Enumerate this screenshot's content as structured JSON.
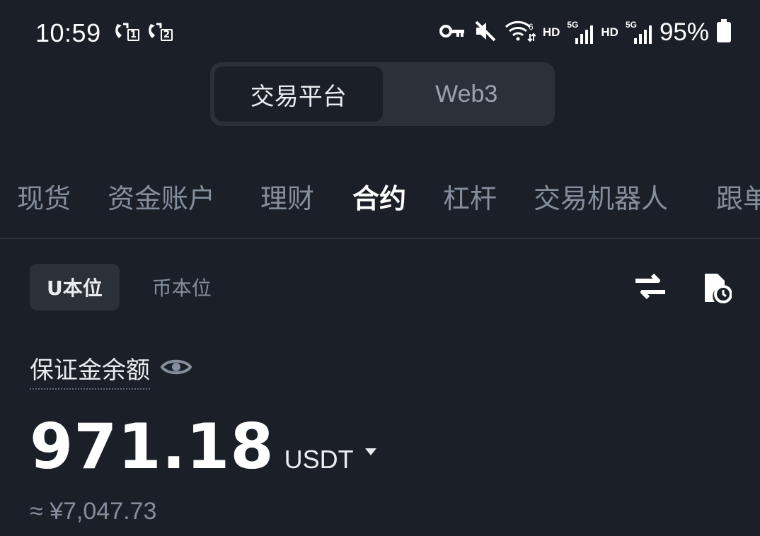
{
  "status_bar": {
    "time": "10:59",
    "sim1": "1",
    "sim2": "2",
    "hd1": "HD",
    "net1": "5G",
    "hd2": "HD",
    "net2": "5G",
    "battery_percent": "95%",
    "icons": [
      "call-sim1-icon",
      "call-sim2-icon",
      "vpn-key-icon",
      "mute-icon",
      "wifi-icon",
      "signal-icon",
      "battery-icon"
    ]
  },
  "platform_switch": {
    "options": [
      "交易平台",
      "Web3"
    ],
    "selected": "交易平台"
  },
  "account_tabs": {
    "items": [
      "现货",
      "资金账户",
      "理财",
      "合约",
      "杠杆",
      "交易机器人",
      "跟单"
    ],
    "selected": "合约"
  },
  "margin_type": {
    "options": [
      "U本位",
      "币本位"
    ],
    "selected": "U本位"
  },
  "toolbar_icons": [
    "transfer-icon",
    "history-icon"
  ],
  "balance": {
    "label": "保证金余额",
    "amount": "971.18",
    "currency": "USDT",
    "fiat_equivalent": "≈ ¥7,047.73"
  },
  "colors": {
    "background": "#1b2028",
    "surface": "#2b3139",
    "text_primary": "#eaecef",
    "text_secondary": "#848e9c"
  }
}
